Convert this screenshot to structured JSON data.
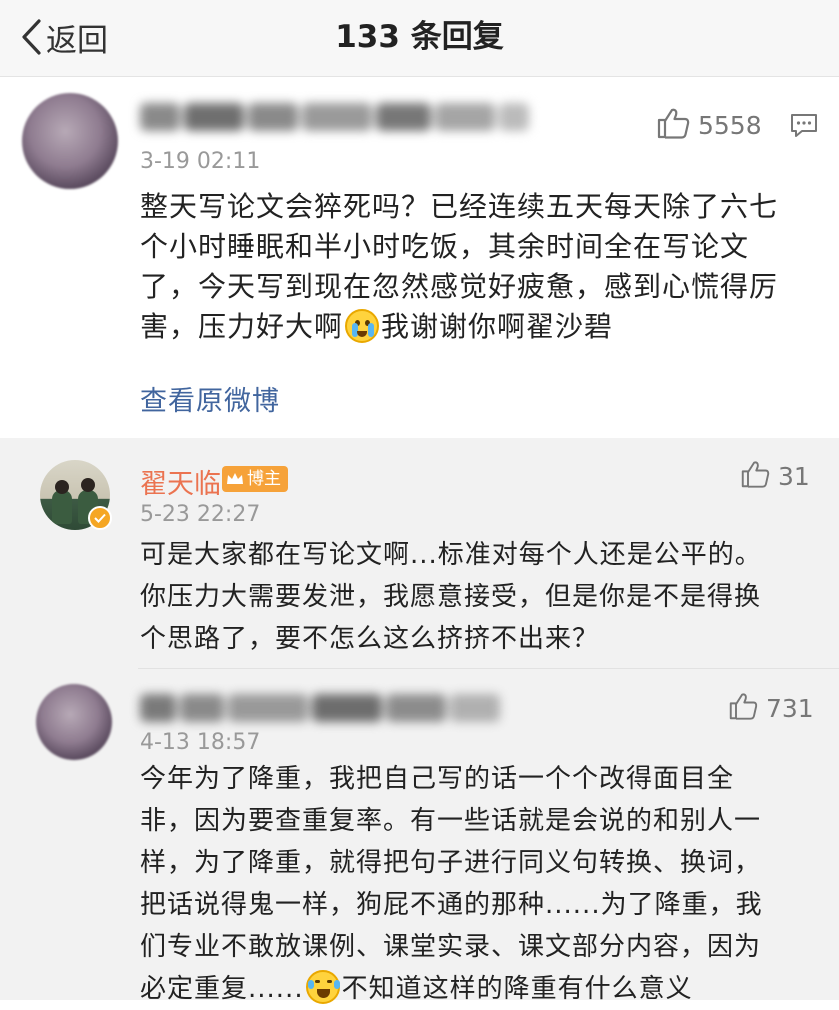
{
  "nav": {
    "back_label": "返回",
    "title": "133 条回复"
  },
  "main_comment": {
    "time": "3-19 02:11",
    "like_count": "5558",
    "text_lines": [
      "整天写论文会猝死吗？已经连续五天每天除了六七",
      "个小时睡眠和半小时吃饭，其余时间全在写论文",
      "了，今天写到现在忽然感觉好疲惫，感到心慌得厉",
      "害，压力好大啊",
      "我谢谢你啊翟沙碧"
    ],
    "emoji": "crying-face",
    "view_original_label": "查看原微博"
  },
  "replies": [
    {
      "author": "翟天临",
      "badge": "博主",
      "time": "5-23 22:27",
      "like_count": "31",
      "text_lines": [
        "可是大家都在写论文啊...标准对每个人还是公平的。",
        "你压力大需要发泄，我愿意接受，但是你是不是得换",
        "个思路了，要不怎么这么挤挤不出来？"
      ]
    },
    {
      "time": "4-13 18:57",
      "like_count": "731",
      "text_lines": [
        "今年为了降重，我把自己写的话一个个改得面目全",
        "非，因为要查重复率。有一些话就是会说的和别人一",
        "样，为了降重，就得把句子进行同义句转换、换词，",
        "把话说得鬼一样，狗屁不通的那种......为了降重，我",
        "们专业不敢放课例、课堂实录、课文部分内容，因为",
        "必定重复......",
        "不知道这样的降重有什么意义"
      ],
      "emoji": "laughing-tears-face"
    }
  ],
  "colors": {
    "author": "#eb7350",
    "link": "#41659e",
    "badge": "#f6a239",
    "nav_bg": "#f7f7f7",
    "reply_bg": "#f2f2f2"
  }
}
